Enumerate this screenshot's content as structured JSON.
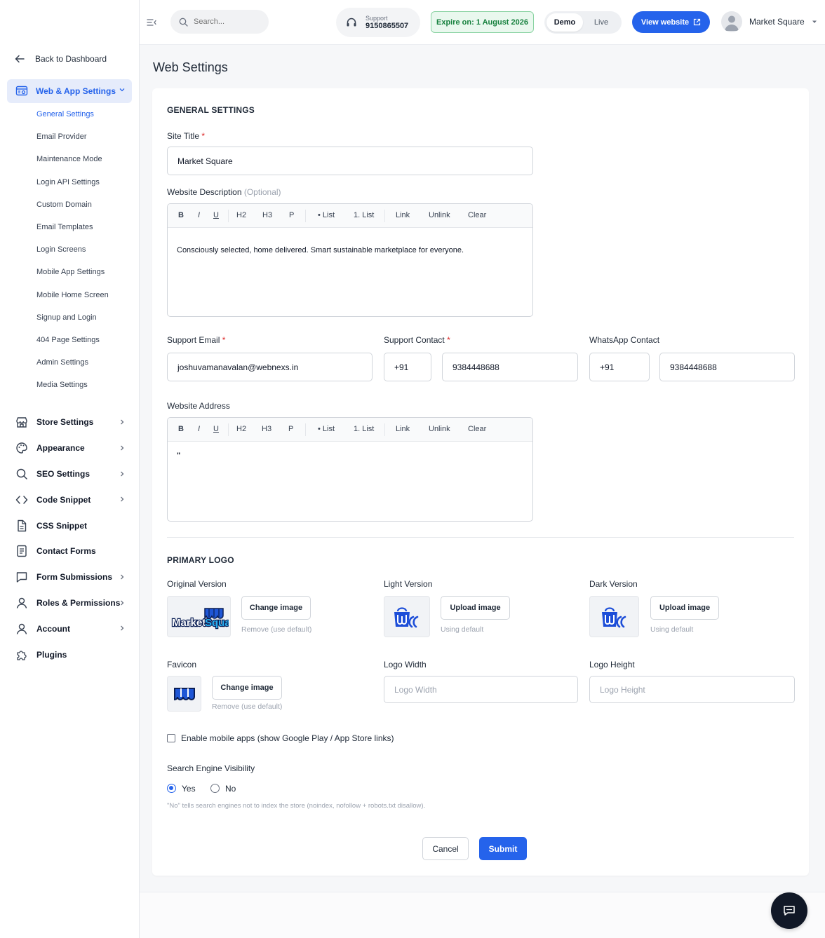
{
  "sidebar": {
    "back_label": "Back to Dashboard",
    "active_section": "Web & App Settings",
    "sub_items": [
      {
        "label": "General Settings",
        "active": true
      },
      {
        "label": "Email Provider"
      },
      {
        "label": "Maintenance Mode"
      },
      {
        "label": "Login API Settings"
      },
      {
        "label": "Custom Domain"
      },
      {
        "label": "Email Templates"
      },
      {
        "label": "Login Screens"
      },
      {
        "label": "Mobile App Settings"
      },
      {
        "label": "Mobile Home Screen"
      },
      {
        "label": "Signup and Login"
      },
      {
        "label": "404 Page Settings"
      },
      {
        "label": "Admin Settings"
      },
      {
        "label": "Media Settings"
      }
    ],
    "nav_items": [
      {
        "label": "Store Settings",
        "icon": "store-icon",
        "has_children": true
      },
      {
        "label": "Appearance",
        "icon": "palette-icon",
        "has_children": true
      },
      {
        "label": "SEO Settings",
        "icon": "search-icon",
        "has_children": true
      },
      {
        "label": "Code Snippet",
        "icon": "code-icon",
        "has_children": true
      },
      {
        "label": "CSS Snippet",
        "icon": "file-icon",
        "has_children": false
      },
      {
        "label": "Contact Forms",
        "icon": "form-icon",
        "has_children": false
      },
      {
        "label": "Form Submissions",
        "icon": "message-icon",
        "has_children": true
      },
      {
        "label": "Roles & Permissions",
        "icon": "user-icon",
        "has_children": true
      },
      {
        "label": "Account",
        "icon": "account-icon",
        "has_children": true
      },
      {
        "label": "Plugins",
        "icon": "puzzle-icon",
        "has_children": false
      }
    ]
  },
  "topbar": {
    "search_placeholder": "Search...",
    "support_label": "Support",
    "support_number": "9150865507",
    "expire_text": "Expire on: 1 August 2026",
    "mode_demo": "Demo",
    "mode_live": "Live",
    "mode_selected": "Demo",
    "view_website": "View website",
    "user_name": "Market Square"
  },
  "page": {
    "title": "Web Settings"
  },
  "general": {
    "section_title": "GENERAL SETTINGS",
    "site_title_label": "Site Title",
    "site_title_value": "Market Square",
    "description_label": "Website Description",
    "description_optional": "(Optional)",
    "description_value": "Consciously selected, home delivered. Smart sustainable marketplace for everyone.",
    "toolbar": {
      "bold": "B",
      "italic": "I",
      "underline": "U",
      "h2": "H2",
      "h3": "H3",
      "p": "P",
      "bullet_list": "• List",
      "ordered_list": "1. List",
      "link": "Link",
      "unlink": "Unlink",
      "clear": "Clear"
    },
    "support_email_label": "Support Email",
    "support_email_value": "joshuvamanavalan@webnexs.in",
    "support_contact_label": "Support Contact",
    "support_contact_code": "+91",
    "support_contact_value": "9384448688",
    "whatsapp_label": "WhatsApp Contact",
    "whatsapp_code": "+91",
    "whatsapp_value": "9384448688",
    "address_label": "Website Address",
    "address_value": "\""
  },
  "logo": {
    "section_title": "PRIMARY LOGO",
    "original_label": "Original Version",
    "original_button": "Change image",
    "original_hint": "Remove (use default)",
    "light_label": "Light Version",
    "light_button": "Upload image",
    "light_hint": "Using default",
    "dark_label": "Dark Version",
    "dark_button": "Upload image",
    "dark_hint": "Using default",
    "favicon_label": "Favicon",
    "favicon_button": "Change image",
    "favicon_hint": "Remove (use default)",
    "logo_width_label": "Logo Width",
    "logo_width_placeholder": "Logo Width",
    "logo_height_label": "Logo Height",
    "logo_height_placeholder": "Logo Height",
    "brand_text": "MarketSquare"
  },
  "options": {
    "mobile_apps_label": "Enable mobile apps (show Google Play / App Store links)",
    "mobile_apps_checked": false,
    "visibility_label": "Search Engine Visibility",
    "visibility_yes": "Yes",
    "visibility_no": "No",
    "visibility_selected": "Yes",
    "visibility_hint": "\"No\" tells search engines not to index the store (noindex, nofollow + robots.txt disallow)."
  },
  "actions": {
    "cancel": "Cancel",
    "submit": "Submit"
  },
  "colors": {
    "accent": "#2563eb",
    "expire_green": "#15803d",
    "required": "#dc2626"
  }
}
